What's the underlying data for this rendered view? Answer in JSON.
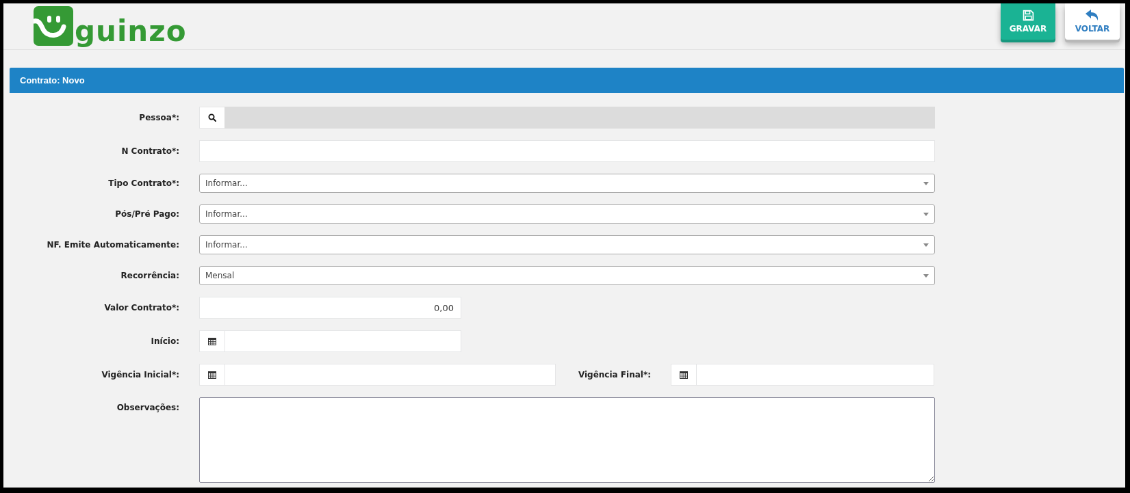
{
  "logo": {
    "text": "guinzo"
  },
  "buttons": [
    {
      "kind": "save",
      "label": "GRAVAR"
    },
    {
      "kind": "back",
      "label": "VOLTAR"
    }
  ],
  "panel": {
    "title": "Contrato: Novo"
  },
  "form": [
    {
      "kind": "lookup",
      "label": "Pessoa*:",
      "disabled": true
    },
    {
      "kind": "text",
      "label": "N Contrato*:"
    },
    {
      "kind": "select",
      "label": "Tipo Contrato*:",
      "value": "Informar..."
    },
    {
      "kind": "select",
      "label": "Pós/Pré Pago:",
      "value": "Informar..."
    },
    {
      "kind": "select",
      "label": "NF. Emite Automaticamente:",
      "value": "Informar..."
    },
    {
      "kind": "select",
      "label": "Recorrência:",
      "value": "Mensal"
    },
    {
      "kind": "number",
      "label": "Valor Contrato*:",
      "value": "0,00"
    },
    {
      "kind": "date",
      "label": "Início:"
    },
    {
      "kind": "date_pair",
      "label": "Vigência Inicial*:",
      "label_2": "Vigência Final*:"
    },
    {
      "kind": "textarea",
      "label": "Observações:"
    }
  ]
}
